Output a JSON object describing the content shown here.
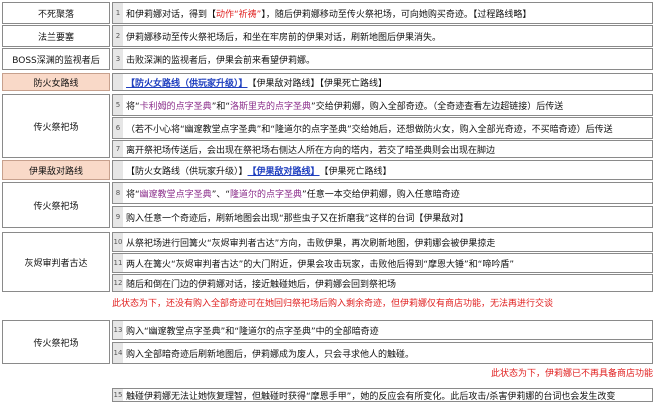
{
  "labels": {
    "bu_si_ju_luo": "不死聚落",
    "fa_lan_yao_sai": "法兰要塞",
    "boss_watchers": "BOSS深渊的监视者后",
    "fang_huo_nv_line": "防火女路线",
    "bonfire_shrine_1": "传火祭祀场",
    "yi_li_di_dui_line": "伊果敌对路线",
    "bonfire_shrine_2": "传火祭祀场",
    "ash_judge": "灰烬审判者古达",
    "bonfire_shrine_3": "传火祭祀场"
  },
  "rows": {
    "r1": {
      "num": "1",
      "a": "和伊莉娜对话，得到【",
      "b": "动作“祈祷”",
      "c": "】，随后伊莉娜移动至传火祭祀场，可向她购买奇迹。【过程路线略】"
    },
    "r2": {
      "num": "2",
      "text": "伊莉娜移动至传火祭祀场后，和坐在牢房前的伊果对话，刷新地图后伊果消失。"
    },
    "r3": {
      "num": "3",
      "text": "击败深渊的监视者后，伊果会前来看望伊莉娜。"
    },
    "r4": {
      "a": "【防火女路线（供玩家升级）】",
      "b": "【伊果敌对路线】【伊果死亡路线】"
    },
    "r5": {
      "num": "5",
      "a": "将“",
      "b": "卡利姆的点字圣典",
      "c": "”和“",
      "d": "洛斯里克的点字圣典",
      "e": "”交给伊莉娜，购入全部奇迹。（全奇迹查看左边超链接）后传送"
    },
    "r6": {
      "num": "6",
      "text": "（若不小心将“幽邃教堂点字圣典”和“隆道尔的点字圣典”交给她后，还想做防火女，购入全部光奇迹，不买暗奇迹）后传送"
    },
    "r7": {
      "num": "7",
      "text": "离开祭祀场传送后，会出现在祭祀场右侧达人所在方向的塔内，若交了暗圣典则会出现在脚边"
    },
    "r8": {
      "a": "【防火女路线（供玩家升级）】",
      "b": "【伊果敌对路线】",
      "c": "【伊果死亡路线】"
    },
    "r9": {
      "num": "8",
      "a": "将“",
      "b": "幽邃教堂点字圣典",
      "c": "”、“",
      "d": "隆道尔的点字圣典",
      "e": "”任意一本交给伊莉娜，购入任意暗奇迹"
    },
    "r10": {
      "num": "9",
      "text": "购入任意一个奇迹后，刷新地图会出现“那些虫子又在折磨我”这样的台词【伊果敌对】"
    },
    "r11": {
      "num": "10",
      "text": "从祭祀场进行回篝火“灰烬审判者古达”方向，击败伊果，再次刷新地图，伊莉娜会被伊果掠走"
    },
    "r12": {
      "num": "11",
      "text": "两人在篝火“灰烬审判者古达”的大门附近，伊果会攻击玩家，击败他后得到“摩恩大锤”和“啼吟盾”"
    },
    "r13": {
      "num": "12",
      "text": "随后和倒在门边的伊莉娜对话，接近触碰她后，伊莉娜会回到祭祀场"
    },
    "note1": "此状态为下，还没有购入全部奇迹可在她回归祭祀场后购入剩余奇迹，但伊莉娜仅有商店功能，无法再进行交谈",
    "r14": {
      "num": "13",
      "text": "购入“幽邃教堂点字圣典”和“隆道尔的点字圣典”中的全部暗奇迹"
    },
    "r15": {
      "num": "14",
      "text": "购入全部暗奇迹后刷新地图后，伊莉娜成为废人，只会寻求他人的触碰。"
    },
    "note2": "此状态为下，伊莉娜已不再具备商店功能",
    "r16": {
      "num": "15",
      "text": "触碰伊莉娜无法让她恢复理智，但触碰时获得“摩恩手甲”，她的反应会有所变化。此后攻击/杀害伊莉娜的台词也会发生改变"
    }
  }
}
